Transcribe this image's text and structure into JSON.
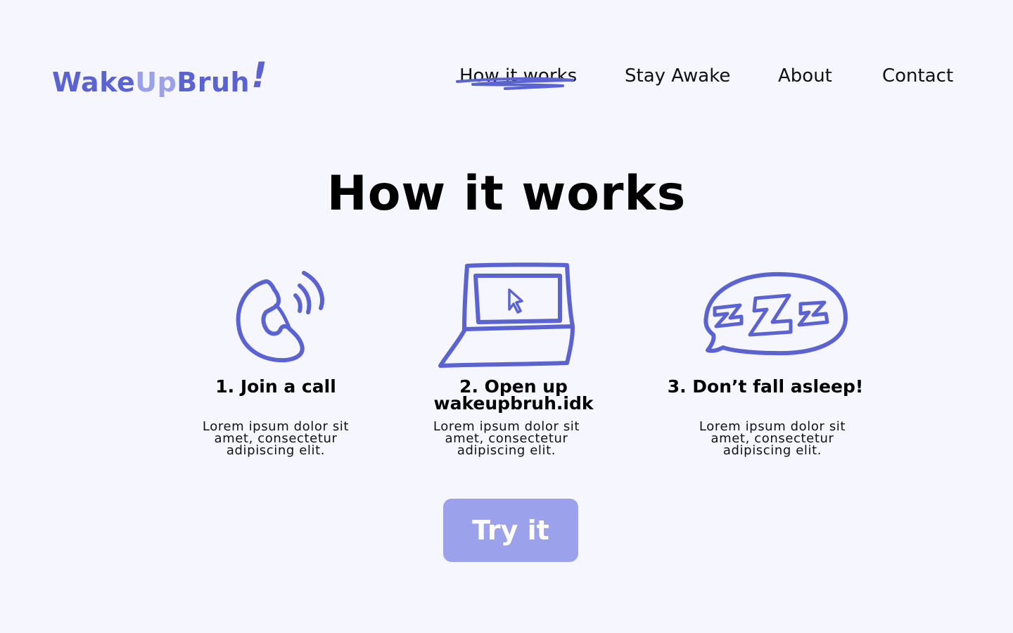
{
  "brand": {
    "logo_part1": "Wake",
    "logo_part2": "Up",
    "logo_part3": "Bruh",
    "logo_part4": "!",
    "colors": {
      "primary": "#5b63d3",
      "light": "#9aa0ea",
      "background": "#f5f6ff"
    }
  },
  "nav": {
    "items": [
      {
        "label": "How it works",
        "active": true
      },
      {
        "label": "Stay Awake"
      },
      {
        "label": "About"
      },
      {
        "label": "Contact"
      }
    ]
  },
  "main": {
    "title": "How it works",
    "steps": [
      {
        "icon": "phone-icon",
        "title": "1. Join a call",
        "description": "Lorem ipsum dolor sit amet, consectetur adipiscing elit."
      },
      {
        "icon": "laptop-icon",
        "title": "2. Open up wakeupbruh.idk",
        "description": "Lorem ipsum dolor sit amet, consectetur adipiscing elit."
      },
      {
        "icon": "sleep-bubble-icon",
        "title": "3. Don’t fall asleep!",
        "description": "Lorem ipsum dolor sit amet, consectetur adipiscing elit."
      }
    ],
    "cta_label": "Try it"
  }
}
